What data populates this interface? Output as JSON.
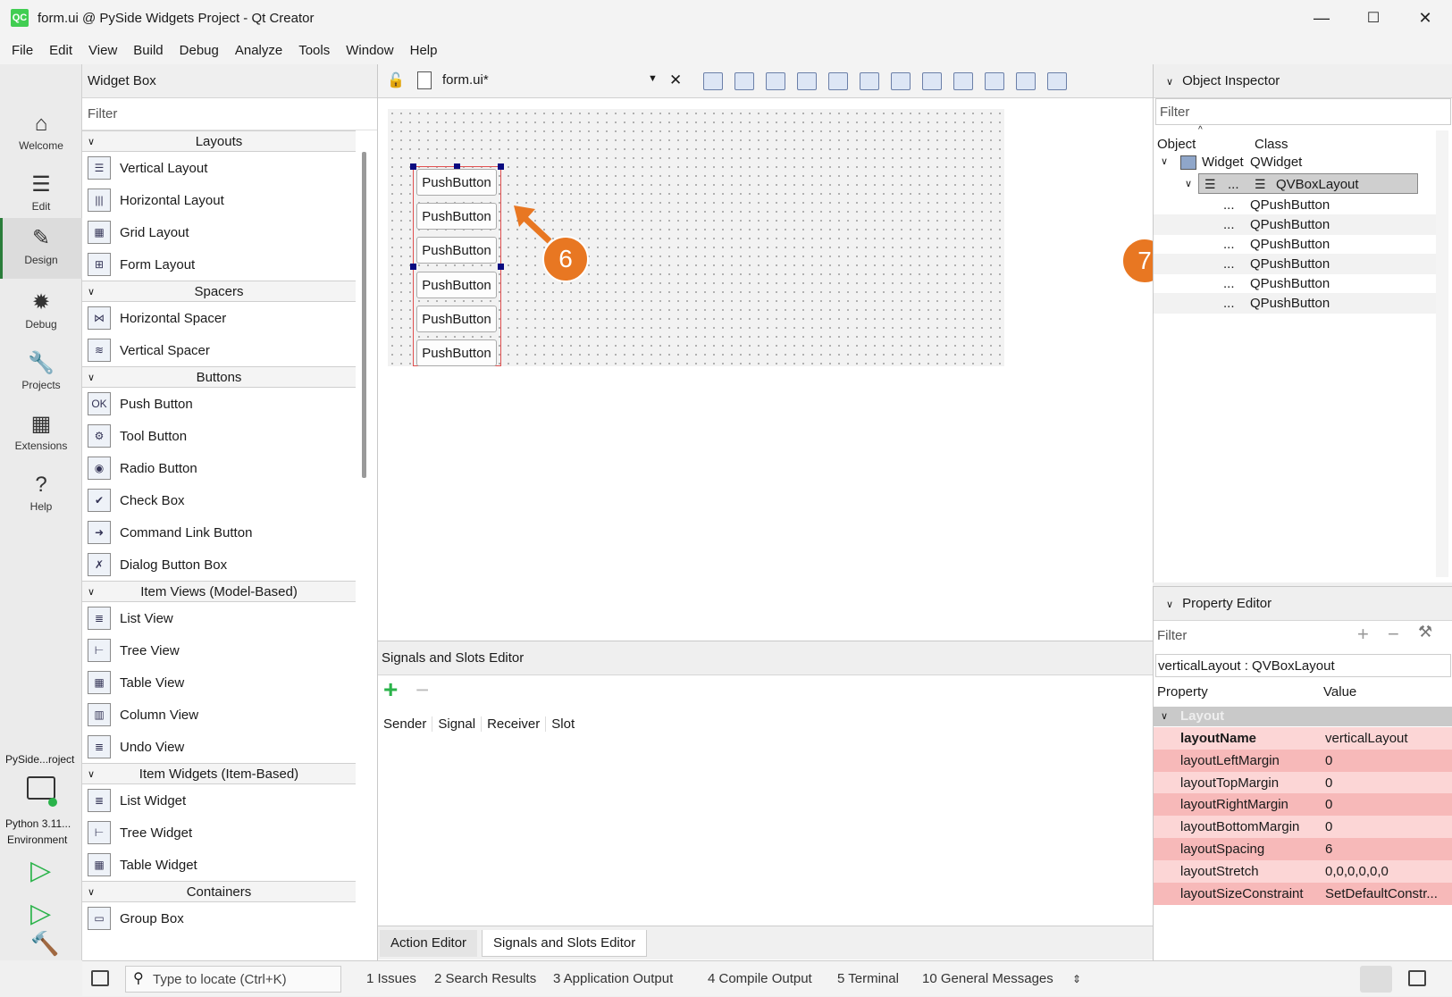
{
  "titlebar": {
    "app_icon": "QC",
    "title": "form.ui @ PySide Widgets Project - Qt Creator",
    "minimize": "—",
    "maximize": "☐",
    "close": "✕"
  },
  "menu": [
    "File",
    "Edit",
    "View",
    "Build",
    "Debug",
    "Analyze",
    "Tools",
    "Window",
    "Help"
  ],
  "modes": [
    {
      "label": "Welcome",
      "icon": "⌂"
    },
    {
      "label": "Edit",
      "icon": "☰"
    },
    {
      "label": "Design",
      "icon": "✎"
    },
    {
      "label": "Debug",
      "icon": "✹"
    },
    {
      "label": "Projects",
      "icon": "🔧"
    },
    {
      "label": "Extensions",
      "icon": "▦"
    },
    {
      "label": "Help",
      "icon": "?"
    }
  ],
  "kit": {
    "project": "PySide...roject",
    "env1": "Python 3.11...",
    "env2": "Environment",
    "run": "▷",
    "debug_run": "▷",
    "build": "🔨"
  },
  "widget_box": {
    "title": "Widget Box",
    "filter_placeholder": "Filter",
    "categories": [
      {
        "name": "Layouts",
        "items": [
          {
            "label": "Vertical Layout",
            "icon": "☰"
          },
          {
            "label": "Horizontal Layout",
            "icon": "|||"
          },
          {
            "label": "Grid Layout",
            "icon": "▦"
          },
          {
            "label": "Form Layout",
            "icon": "⊞"
          }
        ]
      },
      {
        "name": "Spacers",
        "items": [
          {
            "label": "Horizontal Spacer",
            "icon": "⋈"
          },
          {
            "label": "Vertical Spacer",
            "icon": "≋"
          }
        ]
      },
      {
        "name": "Buttons",
        "items": [
          {
            "label": "Push Button",
            "icon": "OK"
          },
          {
            "label": "Tool Button",
            "icon": "⚙"
          },
          {
            "label": "Radio Button",
            "icon": "◉"
          },
          {
            "label": "Check Box",
            "icon": "✔"
          },
          {
            "label": "Command Link Button",
            "icon": "➜"
          },
          {
            "label": "Dialog Button Box",
            "icon": "✗"
          }
        ]
      },
      {
        "name": "Item Views (Model-Based)",
        "items": [
          {
            "label": "List View",
            "icon": "≣"
          },
          {
            "label": "Tree View",
            "icon": "⊢"
          },
          {
            "label": "Table View",
            "icon": "▦"
          },
          {
            "label": "Column View",
            "icon": "▥"
          },
          {
            "label": "Undo View",
            "icon": "≣"
          }
        ]
      },
      {
        "name": "Item Widgets (Item-Based)",
        "items": [
          {
            "label": "List Widget",
            "icon": "≣"
          },
          {
            "label": "Tree Widget",
            "icon": "⊢"
          },
          {
            "label": "Table Widget",
            "icon": "▦"
          }
        ]
      },
      {
        "name": "Containers",
        "items": [
          {
            "label": "Group Box",
            "icon": "▭"
          }
        ]
      }
    ]
  },
  "design_toolbar": {
    "file": "form.ui*",
    "close": "✕"
  },
  "form": {
    "buttons": [
      "PushButton",
      "PushButton",
      "PushButton",
      "PushButton",
      "PushButton",
      "PushButton"
    ]
  },
  "callouts": {
    "six": "6",
    "seven": "7"
  },
  "signals_slots": {
    "title": "Signals and Slots Editor",
    "add": "+",
    "remove": "−",
    "columns": [
      "Sender",
      "Signal",
      "Receiver",
      "Slot"
    ]
  },
  "bottom_tabs": [
    "Action Editor",
    "Signals and Slots Editor"
  ],
  "object_inspector": {
    "title": "Object Inspector",
    "filter_placeholder": "Filter",
    "columns": [
      "Object",
      "Class"
    ],
    "rows": [
      {
        "object": "Widget",
        "class": "QWidget"
      },
      {
        "object": "...",
        "class": "QVBoxLayout"
      },
      {
        "object": "...",
        "class": "QPushButton"
      },
      {
        "object": "...",
        "class": "QPushButton"
      },
      {
        "object": "...",
        "class": "QPushButton"
      },
      {
        "object": "...",
        "class": "QPushButton"
      },
      {
        "object": "...",
        "class": "QPushButton"
      },
      {
        "object": "...",
        "class": "QPushButton"
      }
    ]
  },
  "property_editor": {
    "title": "Property Editor",
    "filter_placeholder": "Filter",
    "selected": "verticalLayout : QVBoxLayout",
    "columns": [
      "Property",
      "Value"
    ],
    "group": "Layout",
    "rows": [
      {
        "name": "layoutName",
        "value": "verticalLayout"
      },
      {
        "name": "layoutLeftMargin",
        "value": "0"
      },
      {
        "name": "layoutTopMargin",
        "value": "0"
      },
      {
        "name": "layoutRightMargin",
        "value": "0"
      },
      {
        "name": "layoutBottomMargin",
        "value": "0"
      },
      {
        "name": "layoutSpacing",
        "value": "6"
      },
      {
        "name": "layoutStretch",
        "value": "0,0,0,0,0,0"
      },
      {
        "name": "layoutSizeConstraint",
        "value": "SetDefaultConstr..."
      }
    ]
  },
  "statusbar": {
    "locate_placeholder": "Type to locate (Ctrl+K)",
    "panes": [
      "1  Issues",
      "2  Search Results",
      "3  Application Output",
      "4  Compile Output",
      "5  Terminal",
      "10  General Messages"
    ]
  }
}
